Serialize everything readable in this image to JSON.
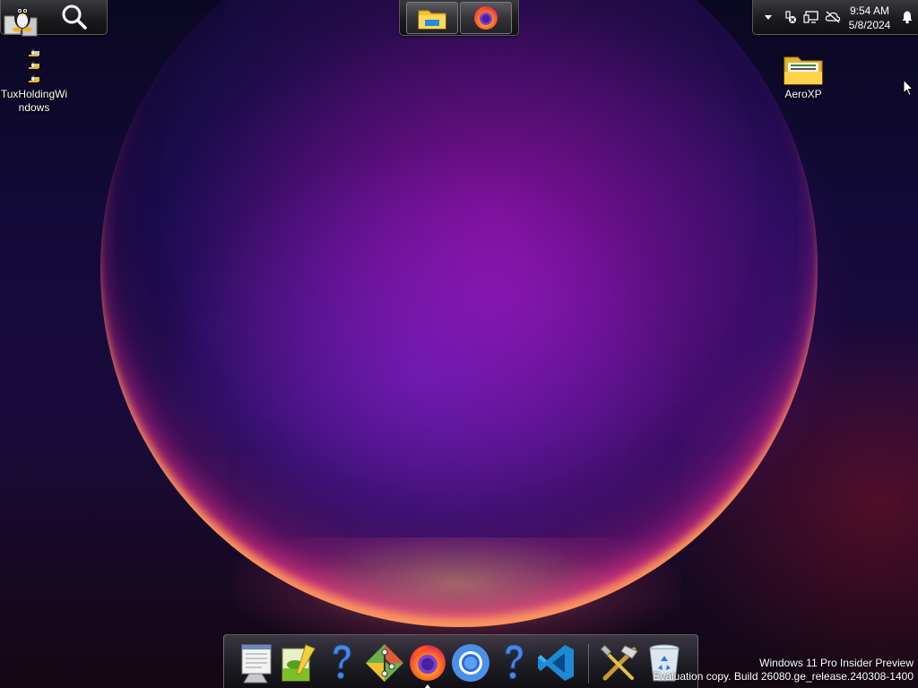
{
  "taskbar_left": {
    "tux_icon": "tux-penguin-icon",
    "search_icon": "search-icon"
  },
  "taskbar_center": {
    "items": [
      {
        "name": "File Explorer",
        "icon": "folder-icon"
      },
      {
        "name": "Firefox",
        "icon": "firefox-icon"
      }
    ]
  },
  "tray": {
    "icons": [
      "chevron-up-icon",
      "network-disconnected-icon",
      "display-icon",
      "cloud-offline-icon",
      "notification-bell-icon"
    ],
    "time": "9:54 AM",
    "date": "5/8/2024"
  },
  "desktop_icons": [
    {
      "label": "TuxHoldingWindows",
      "icon": "tux-holding-windows-icon"
    },
    {
      "label": "AeroXP",
      "icon": "folder-icon"
    }
  ],
  "dock": {
    "items": [
      {
        "name": "Notepad",
        "icon": "notepad-icon"
      },
      {
        "name": "Notepad++",
        "icon": "notepadpp-icon"
      },
      {
        "name": "Help",
        "icon": "help-icon"
      },
      {
        "name": "Git",
        "icon": "git-icon"
      },
      {
        "name": "Firefox",
        "icon": "firefox-icon"
      },
      {
        "name": "Chromium",
        "icon": "chromium-icon"
      },
      {
        "name": "Help",
        "icon": "help-icon"
      },
      {
        "name": "Visual Studio Code",
        "icon": "vscode-icon"
      },
      {
        "name": "Tools",
        "icon": "tools-icon"
      },
      {
        "name": "Recycle Bin",
        "icon": "recycle-bin-icon"
      }
    ]
  },
  "watermark": {
    "line1": "Windows 11 Pro Insider Preview",
    "line2": "Evaluation copy. Build 26080.ge_release.240308-1400"
  },
  "colors": {
    "background_dark": "#0a0820",
    "arc_magenta": "#c814d2",
    "arc_orange": "#ffaa50",
    "taskbar": "#1c1c20"
  }
}
